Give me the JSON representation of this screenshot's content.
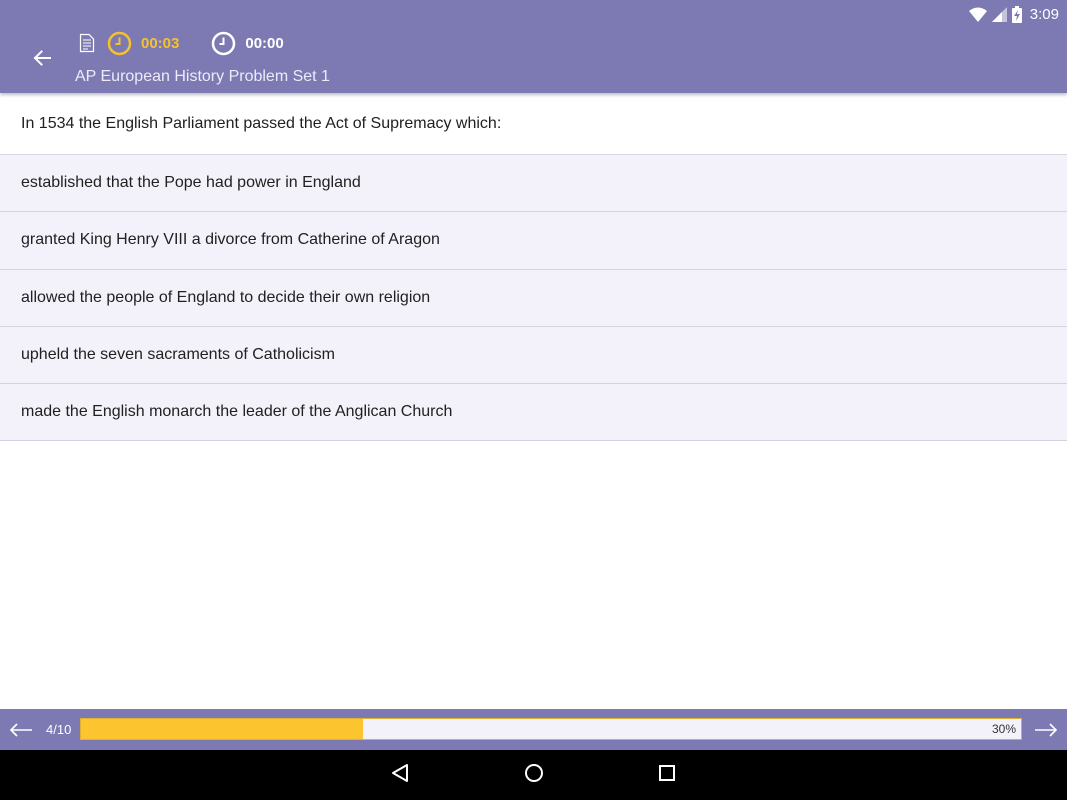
{
  "status": {
    "time": "3:09",
    "icons": [
      "wifi-icon",
      "cell-signal-icon",
      "battery-charging-icon"
    ]
  },
  "header": {
    "question_timer": "00:03",
    "total_timer": "00:00",
    "title": "AP European History Problem Set 1",
    "question_timer_color": "#f6c22b",
    "bar_color": "#7d7ab3"
  },
  "question": {
    "text": "In 1534 the English Parliament passed the Act of Supremacy which:",
    "answers": [
      "established that the Pope had power in England",
      "granted King Henry VIII a divorce from Catherine of Aragon",
      "allowed the people of England to decide their own religion",
      "upheld the seven sacraments of Catholicism",
      "made the English monarch the leader of the Anglican Church"
    ]
  },
  "progress": {
    "count": "4/10",
    "percent_label": "30%",
    "percent": 30,
    "fill_color": "#fcc530"
  },
  "nav": {
    "icons": [
      "back-triangle-icon",
      "home-circle-icon",
      "recents-square-icon"
    ]
  }
}
